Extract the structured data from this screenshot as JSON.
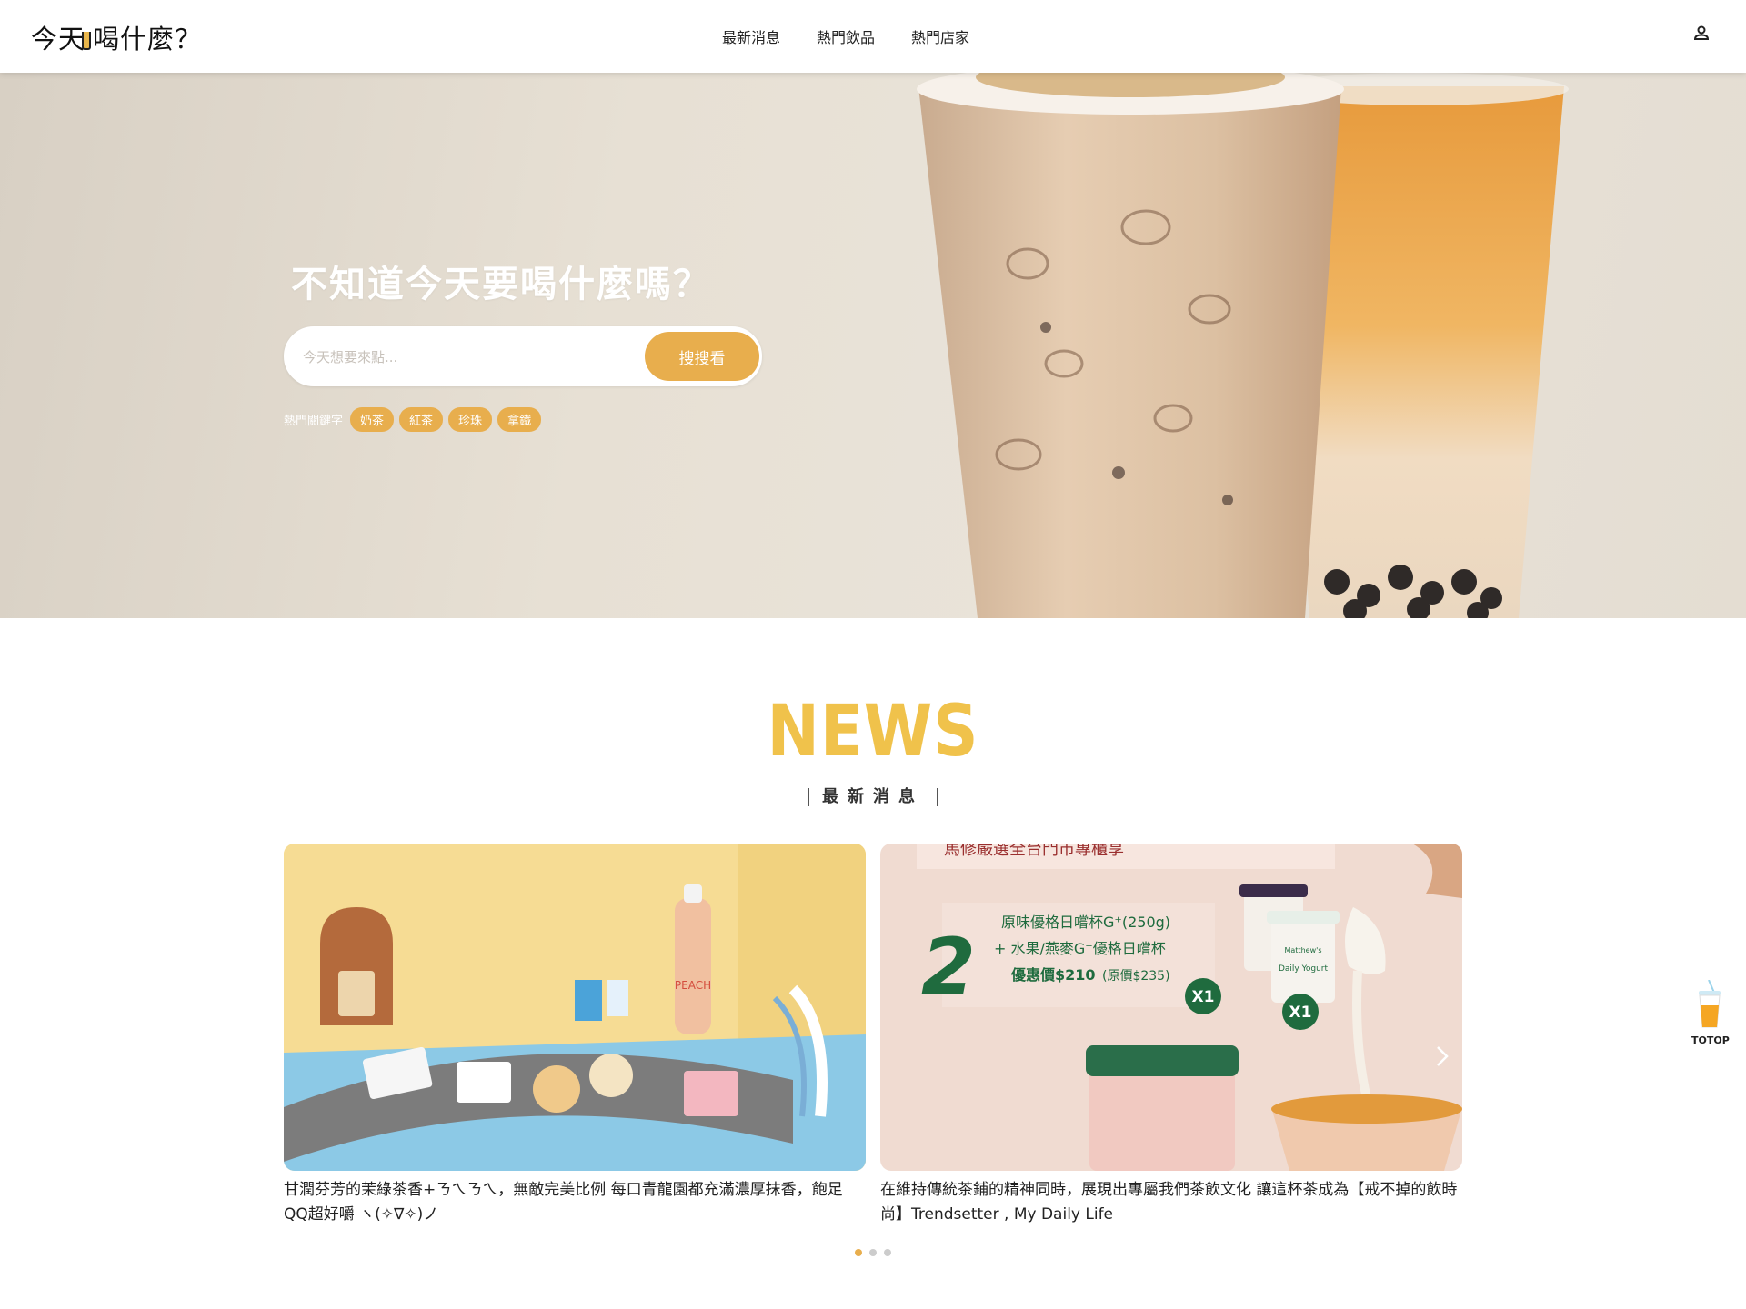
{
  "brand": {
    "logo_text_a": "今天",
    "logo_text_b": "喝什麼？"
  },
  "nav": {
    "items": [
      "最新消息",
      "熱門飲品",
      "熱門店家"
    ]
  },
  "hero": {
    "title": "不知道今天要喝什麼嗎？",
    "search_placeholder": "今天想要來點...",
    "search_button": "搜搜看",
    "keywords_label": "熱門關鍵字",
    "keywords": [
      "奶茶",
      "紅茶",
      "珍珠",
      "拿鐵"
    ]
  },
  "news": {
    "heading": "NEWS",
    "subheading": "最新消息",
    "cards": [
      {
        "caption": "甘潤芬芳的茉綠茶香+ㄋㄟㄋㄟ，無敵完美比例 每口青龍園都充滿濃厚抹香，飽足QQ超好嚼 ヽ(✧∇✧)ノ",
        "image_text": {
          "bottle": "PEACH"
        }
      },
      {
        "caption": "在維持傳統茶鋪的精神同時，展現出專屬我們茶飲文化 讓這杯茶成為【戒不掉的飲時尚】Trendsetter , My Daily Life",
        "image_text": {
          "banner": "馬修嚴選全台門市專櫃享",
          "big_number": "2",
          "line1": "原味優格日嚐杯G⁺(250g)",
          "line2": "+ 水果/燕麥G⁺優格日嚐杯",
          "line3_main": "優惠價$210",
          "line3_sub": "(原價$235)",
          "badge": "X1",
          "cup_label": "Daily Yogurt",
          "cup_brand": "Matthew's"
        }
      }
    ],
    "dots": 3,
    "active_dot": 0
  },
  "totop": {
    "label": "TOTOP"
  },
  "colors": {
    "accent": "#e8ae4d",
    "news_heading": "#f0c24b",
    "green": "#1f6b3e"
  }
}
